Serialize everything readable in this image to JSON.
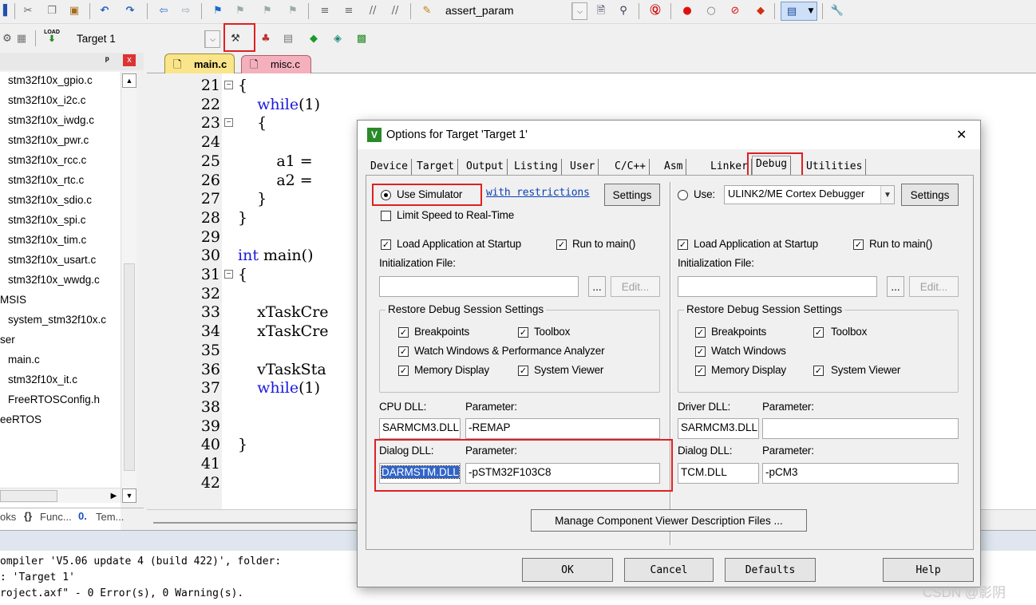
{
  "toolbar1": {
    "icons": [
      "dock-icon",
      "cut-icon",
      "copy-icon",
      "paste-icon",
      "undo-icon",
      "redo-icon",
      "back-icon",
      "forward-icon",
      "bookmark-icon",
      "bookmark-prev-icon",
      "bookmark-next-icon",
      "bookmark-clear-icon",
      "indent-icon",
      "unindent-icon",
      "comment-icon",
      "uncomment-icon",
      "find-in-files-icon"
    ],
    "find_value": "assert_param",
    "extra_icons": [
      "find-icon",
      "incremental-find-icon",
      "debug-session-icon",
      "breakpoint-icon",
      "breakpoint-disable-icon",
      "breakpoint-kill-icon",
      "breakpoint-kill-all-icon",
      "window-layout-icon",
      "configure-icon"
    ]
  },
  "toolbar2": {
    "load_label": "LOAD",
    "target_value": "Target 1",
    "icons": [
      "target-options-icon",
      "manage-project-icon",
      "file-extensions-icon",
      "pack-installer-icon",
      "select-pack-icon",
      "run-time-env-icon"
    ]
  },
  "project_pane": {
    "items": [
      {
        "label": "stm32f10x_gpio.c",
        "indent": true
      },
      {
        "label": "stm32f10x_i2c.c",
        "indent": true
      },
      {
        "label": "stm32f10x_iwdg.c",
        "indent": true
      },
      {
        "label": "stm32f10x_pwr.c",
        "indent": true
      },
      {
        "label": "stm32f10x_rcc.c",
        "indent": true
      },
      {
        "label": "stm32f10x_rtc.c",
        "indent": true
      },
      {
        "label": "stm32f10x_sdio.c",
        "indent": true
      },
      {
        "label": "stm32f10x_spi.c",
        "indent": true
      },
      {
        "label": "stm32f10x_tim.c",
        "indent": true
      },
      {
        "label": "stm32f10x_usart.c",
        "indent": true
      },
      {
        "label": "stm32f10x_wwdg.c",
        "indent": true
      },
      {
        "label": "MSIS",
        "indent": false
      },
      {
        "label": "system_stm32f10x.c",
        "indent": true
      },
      {
        "label": "ser",
        "indent": false
      },
      {
        "label": "main.c",
        "indent": true
      },
      {
        "label": "stm32f10x_it.c",
        "indent": true
      },
      {
        "label": "FreeRTOSConfig.h",
        "indent": true
      },
      {
        "label": "eeRTOS",
        "indent": false
      }
    ],
    "bottom_tabs": [
      "oks",
      "Func...",
      "Tem..."
    ],
    "pin_label": "ᵖ",
    "close_label": "x"
  },
  "editor": {
    "tabs": [
      {
        "label": "main.c",
        "active": true
      },
      {
        "label": "misc.c",
        "active": false
      }
    ],
    "lines": [
      {
        "n": "21",
        "fold": "minus",
        "code": "{"
      },
      {
        "n": "22",
        "fold": "",
        "code": "    while(1)"
      },
      {
        "n": "23",
        "fold": "minus",
        "code": "    {"
      },
      {
        "n": "24",
        "fold": "",
        "code": ""
      },
      {
        "n": "25",
        "fold": "",
        "code": "        a1 ="
      },
      {
        "n": "26",
        "fold": "",
        "code": "        a2 ="
      },
      {
        "n": "27",
        "fold": "",
        "code": "    }"
      },
      {
        "n": "28",
        "fold": "",
        "code": "}"
      },
      {
        "n": "29",
        "fold": "",
        "code": ""
      },
      {
        "n": "30",
        "fold": "",
        "code": "int main()"
      },
      {
        "n": "31",
        "fold": "minus",
        "code": "{"
      },
      {
        "n": "32",
        "fold": "",
        "code": ""
      },
      {
        "n": "33",
        "fold": "",
        "code": "    xTaskCre"
      },
      {
        "n": "34",
        "fold": "",
        "code": "    xTaskCre"
      },
      {
        "n": "35",
        "fold": "",
        "code": ""
      },
      {
        "n": "36",
        "fold": "",
        "code": "    vTaskSta"
      },
      {
        "n": "37",
        "fold": "",
        "code": "    while(1)"
      },
      {
        "n": "38",
        "fold": "",
        "code": ""
      },
      {
        "n": "39",
        "fold": "",
        "code": ""
      },
      {
        "n": "40",
        "fold": "",
        "code": "}"
      },
      {
        "n": "41",
        "fold": "",
        "code": ""
      },
      {
        "n": "42",
        "fold": "",
        "code": ""
      }
    ]
  },
  "output": {
    "lines": [
      "ompiler 'V5.06 update 4 (build 422)', folder:",
      ": 'Target 1'",
      "roject.axf\" - 0 Error(s), 0 Warning(s)."
    ]
  },
  "dialog": {
    "title": "Options for Target 'Target 1'",
    "close_label": "✕",
    "tabs": [
      "Device",
      "Target",
      "Output",
      "Listing",
      "User",
      "C/C++",
      "Asm",
      "Linker",
      "Debug",
      "Utilities"
    ],
    "active_tab": "Debug",
    "left": {
      "use_simulator_label": "Use Simulator",
      "restrictions_link": "with restrictions",
      "settings_label": "Settings",
      "limit_speed_label": "Limit Speed to Real-Time",
      "load_app_label": "Load Application at Startup",
      "run_to_main_label": "Run to main()",
      "init_file_label": "Initialization File:",
      "init_file_value": "",
      "browse_label": "...",
      "edit_label": "Edit...",
      "restore_group_label": "Restore Debug Session Settings",
      "breakpoints_label": "Breakpoints",
      "toolbox_label": "Toolbox",
      "watch_label": "Watch Windows & Performance Analyzer",
      "memory_label": "Memory Display",
      "system_viewer_label": "System Viewer",
      "cpu_dll_label": "CPU DLL:",
      "param_label": "Parameter:",
      "cpu_dll_value": "SARMCM3.DLL",
      "cpu_param_value": "-REMAP",
      "dialog_dll_label": "Dialog DLL:",
      "dialog_param_label": "Parameter:",
      "dialog_dll_value": "DARMSTM.DLL",
      "dialog_param_value": "-pSTM32F103C8"
    },
    "right": {
      "use_label": "Use:",
      "debugger_value": "ULINK2/ME Cortex Debugger",
      "settings_label": "Settings",
      "load_app_label": "Load Application at Startup",
      "run_to_main_label": "Run to main()",
      "init_file_label": "Initialization File:",
      "init_file_value": "",
      "browse_label": "...",
      "edit_label": "Edit...",
      "restore_group_label": "Restore Debug Session Settings",
      "breakpoints_label": "Breakpoints",
      "toolbox_label": "Toolbox",
      "watch_label": "Watch Windows",
      "memory_label": "Memory Display",
      "system_viewer_label": "System Viewer",
      "driver_dll_label": "Driver DLL:",
      "param_label": "Parameter:",
      "driver_dll_value": "SARMCM3.DLL",
      "driver_param_value": "",
      "dialog_dll_label": "Dialog DLL:",
      "dialog_param_label": "Parameter:",
      "dialog_dll_value": "TCM.DLL",
      "dialog_param_value": "-pCM3"
    },
    "manage_label": "Manage Component Viewer Description Files ...",
    "ok_label": "OK",
    "cancel_label": "Cancel",
    "defaults_label": "Defaults",
    "help_label": "Help"
  },
  "watermark": "CSDN @影阴",
  "colors": {
    "keyword": "#1a1ae0",
    "highlight_box": "#e02020",
    "link": "#0b3fb5",
    "selection": "#3164c8",
    "active_tab": "#fbe58a",
    "inactive_tab": "#f4b0bd"
  }
}
